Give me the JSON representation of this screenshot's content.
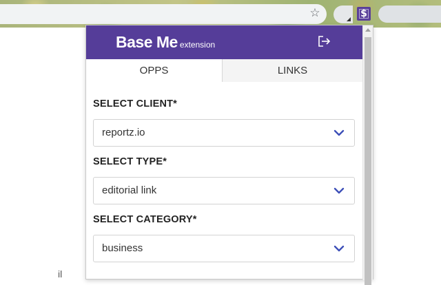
{
  "browser": {
    "star_glyph": "☆",
    "extension_glyph": "$"
  },
  "page": {
    "fragment_text": "il"
  },
  "popup": {
    "brand": "Base Me",
    "brand_suffix": "extension",
    "header_color": "#553d99",
    "tabs": [
      {
        "label": "OPPS",
        "active": true
      },
      {
        "label": "LINKS",
        "active": false
      }
    ],
    "fields": [
      {
        "label": "SELECT CLIENT*",
        "value": "reportz.io"
      },
      {
        "label": "SELECT TYPE*",
        "value": "editorial link"
      },
      {
        "label": "SELECT CATEGORY*",
        "value": "business"
      }
    ],
    "accent_color": "#3d4fb8"
  }
}
